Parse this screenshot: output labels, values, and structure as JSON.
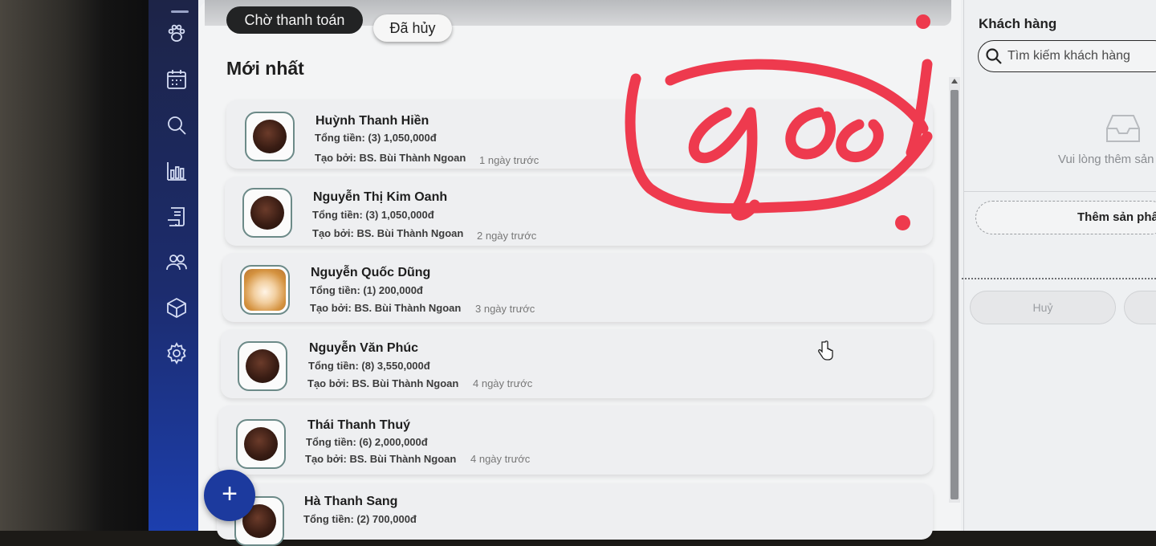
{
  "tabs": [
    {
      "label": "Chờ thanh toán",
      "active": true
    },
    {
      "label": "Đã hủy",
      "active": false
    }
  ],
  "section_title": "Mới nhất",
  "orders": [
    {
      "name": "Huỳnh Thanh Hiền",
      "total": "Tổng tiền: (3) 1,050,000đ",
      "created_by": "Tạo bởi: BS. Bùi Thành Ngoan",
      "time": "1 ngày trước",
      "avatar": "dark-dog-photo"
    },
    {
      "name": "Nguyễn Thị Kim Oanh",
      "total": "Tổng tiền: (3) 1,050,000đ",
      "created_by": "Tạo bởi: BS. Bùi Thành Ngoan",
      "time": "2 ngày trước",
      "avatar": "dark-dog-photo"
    },
    {
      "name": "Nguyễn Quốc Dũng",
      "total": "Tổng tiền: (1) 200,000đ",
      "created_by": "Tạo bởi: BS. Bùi Thành Ngoan",
      "time": "3 ngày trước",
      "avatar": "shiba-dog-photo"
    },
    {
      "name": "Nguyễn Văn Phúc",
      "total": "Tổng tiền: (8) 3,550,000đ",
      "created_by": "Tạo bởi: BS. Bùi Thành Ngoan",
      "time": "4 ngày trước",
      "avatar": "dark-dog-photo"
    },
    {
      "name": "Thái Thanh Thuý",
      "total": "Tổng tiền: (6) 2,000,000đ",
      "created_by": "Tạo bởi: BS. Bùi Thành Ngoan",
      "time": "4 ngày trước",
      "avatar": "dark-dog-photo"
    },
    {
      "name": "Hà Thanh Sang",
      "total": "Tổng tiền: (2) 700,000đ",
      "created_by": "",
      "time": "",
      "avatar": "dark-dog-photo"
    }
  ],
  "sidebar_icons": [
    "paw-icon",
    "calendar-icon",
    "search-icon",
    "bar-chart-icon",
    "receipt-icon",
    "users-icon",
    "box-icon",
    "gear-icon"
  ],
  "fab_label": "+",
  "right_panel": {
    "title": "Khách hàng",
    "search_placeholder": "Tìm kiếm khách hàng",
    "empty_text": "Vui lòng thêm sản",
    "add_product_label": "Thêm sản phẩ",
    "cancel_label": "Huỷ"
  },
  "colors": {
    "sidebar": "#1c2c6e",
    "accent_blue": "#1c3a9e",
    "active_tab": "#222324",
    "annotation_red": "#ee3a4e"
  }
}
